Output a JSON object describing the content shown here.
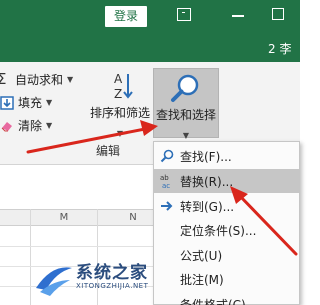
{
  "titlebar": {
    "login": "登录",
    "user_fragment": "2 李"
  },
  "ribbon": {
    "autosum": "自动求和",
    "fill": "填充",
    "clear": "清除",
    "sort_filter": "排序和筛选",
    "find_select": "查找和选择",
    "group_label": "编辑"
  },
  "grid": {
    "columns": [
      "M",
      "N"
    ]
  },
  "find_menu": {
    "items": [
      {
        "label": "查找(F)...",
        "icon": "search-icon"
      },
      {
        "label": "替换(R)...",
        "icon": "replace-icon",
        "highlighted": true
      },
      {
        "label": "转到(G)...",
        "icon": "goto-arrow-icon"
      },
      {
        "label": "定位条件(S)...",
        "icon": ""
      },
      {
        "label": "公式(U)",
        "icon": ""
      },
      {
        "label": "批注(M)",
        "icon": ""
      },
      {
        "label": "条件格式(C)",
        "icon": ""
      }
    ]
  },
  "watermark": {
    "name": "系统之家",
    "url": "XITONGZHIJIA.NET"
  },
  "colors": {
    "excel_green": "#217346",
    "highlight": "#c6c6c6",
    "arrow_red": "#d9261c"
  }
}
